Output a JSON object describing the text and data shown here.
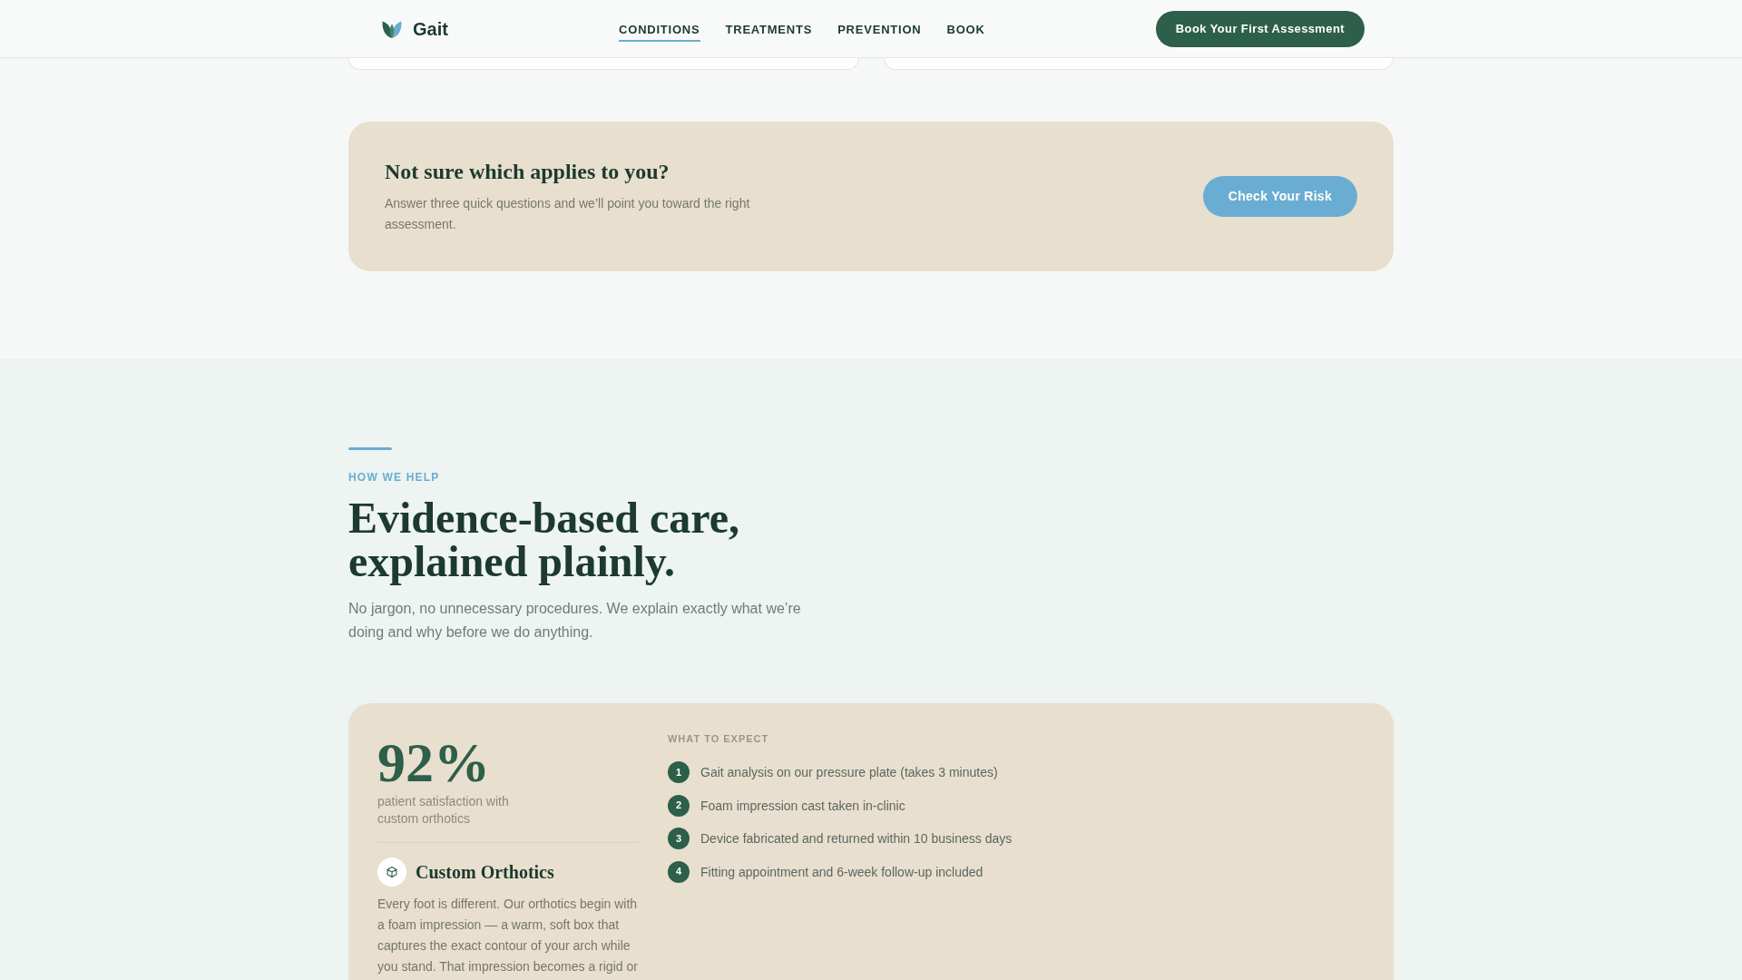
{
  "header": {
    "brand": "Gait",
    "nav": [
      {
        "label": "CONDITIONS",
        "selected": true
      },
      {
        "label": "TREATMENTS",
        "selected": false
      },
      {
        "label": "PREVENTION",
        "selected": false
      },
      {
        "label": "BOOK",
        "selected": false
      }
    ],
    "button": "Book Your First Assessment"
  },
  "risk_check": {
    "title": "Not sure which applies to you?",
    "text": "Answer three quick questions and we’ll point you toward the right assessment.",
    "button": "Check Your Risk"
  },
  "how_we_help": {
    "eyebrow": "HOW WE HELP",
    "heading": "Evidence-based care, explained plainly.",
    "intro": "No jargon, no unnecessary procedures. We explain exactly what we’re doing and why before we do anything.",
    "treatment": {
      "stat": "92%",
      "stat_caption": "patient satisfaction with custom orthotics",
      "title": "Custom Orthotics",
      "description": "Every foot is different. Our orthotics begin with a foam impression — a warm, soft box that captures the exact contour of your arch while you stand. That impression becomes a rigid or",
      "steps_label": "WHAT TO EXPECT",
      "steps": [
        {
          "number": "1",
          "text": "Gait analysis on our pressure plate (takes 3 minutes)"
        },
        {
          "number": "2",
          "text": "Foam impression cast taken in-clinic"
        },
        {
          "number": "3",
          "text": "Device fabricated and returned within 10 business days"
        },
        {
          "number": "4",
          "text": "Fitting appointment and 6-week follow-up included"
        }
      ]
    }
  }
}
